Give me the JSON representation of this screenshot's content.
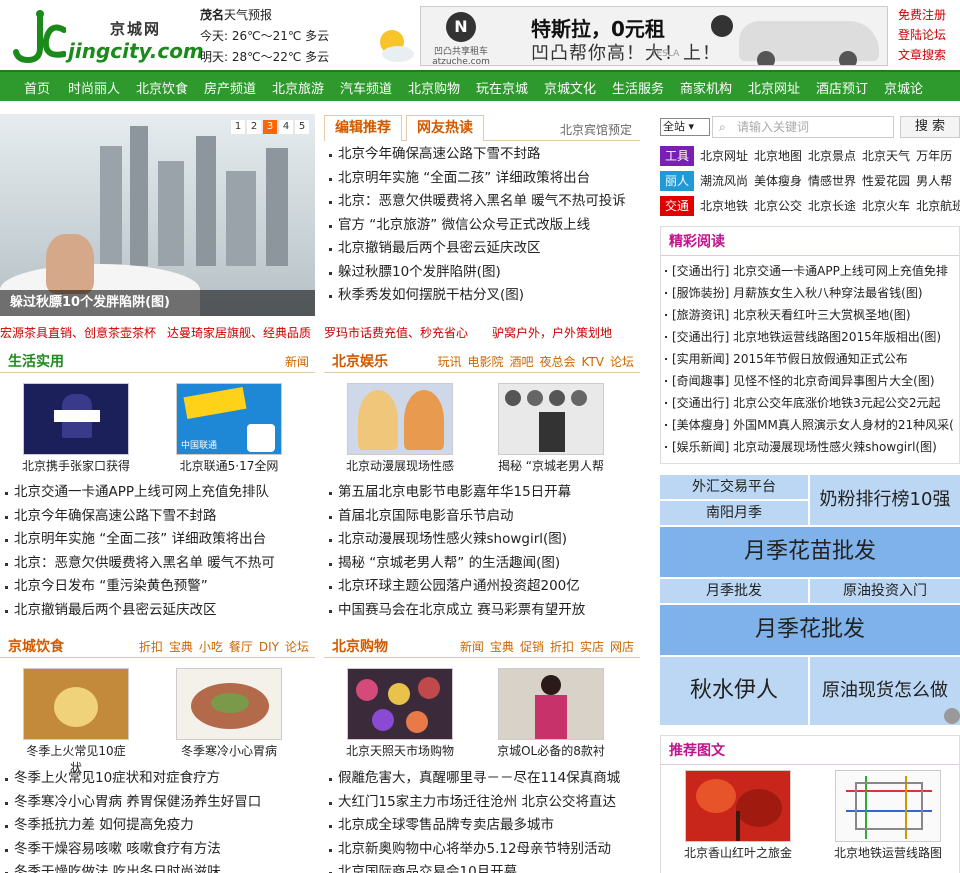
{
  "header": {
    "logo_cn": "京城网",
    "logo_en": "jingcity.com",
    "weather": {
      "location": "茂名",
      "label": "天气预报",
      "today": "今天: 26℃～21℃  多云",
      "tomorrow": "明天: 28℃～22℃  多云"
    },
    "ad": {
      "brand_name": "凹凸共享租车",
      "brand_url": "atzuche.com",
      "headline": "特斯拉，0元租",
      "subline": "凹凸帮你高！大！上！",
      "car_brand": "TESLA"
    },
    "top_links": [
      "免费注册",
      "登陆论坛",
      "文章搜索"
    ]
  },
  "nav": [
    "首页",
    "时尚丽人",
    "北京饮食",
    "房产频道",
    "北京旅游",
    "汽车频道",
    "北京购物",
    "玩在京城",
    "京城文化",
    "生活服务",
    "商家机构",
    "北京网址",
    "酒店预订",
    "京城论"
  ],
  "slideshow": {
    "caption": "躲过秋膘10个发胖陷阱(图)",
    "pages": [
      "1",
      "2",
      "3",
      "4",
      "5"
    ],
    "active_page": "3"
  },
  "promos": [
    "宏源茶具直销、创意茶壶茶杯",
    "达曼琦家居旗舰、经典品质",
    "罗玛市话费充值、秒充省心",
    "驴窝户外，户外策划地"
  ],
  "editor_tabs": {
    "tab1": "编辑推荐",
    "tab2": "网友热读",
    "right": "北京宾馆预定",
    "items": [
      "北京今年确保高速公路下雪不封路",
      "北京明年实施 “全面二孩” 详细政策将出台",
      "北京：恶意欠供暖费将入黑名单  暖气不热可投诉",
      "官方 “北京旅游” 微信公众号正式改版上线",
      "北京撤销最后两个县密云延庆改区",
      "躲过秋膘10个发胖陷阱(图)",
      "秋季秀发如何摆脱干枯分叉(图)"
    ]
  },
  "life": {
    "title": "生活实用",
    "more": [
      "新闻"
    ],
    "thumbs": [
      "北京携手张家口获得",
      "北京联通5·17全网"
    ],
    "items": [
      "北京交通一卡通APP上线可网上充值免排队",
      "北京今年确保高速公路下雪不封路",
      "北京明年实施 “全面二孩” 详细政策将出台",
      "北京：恶意欠供暖费将入黑名单  暖气不热可",
      "北京今日发布 “重污染黄色预警”",
      "北京撤销最后两个县密云延庆改区"
    ],
    "ad_label": "中国联通"
  },
  "ent": {
    "title": "北京娱乐",
    "more": [
      "玩讯",
      "电影院",
      "酒吧",
      "夜总会",
      "KTV",
      "论坛"
    ],
    "thumbs": [
      "北京动漫展现场性感",
      "揭秘 “京城老男人帮"
    ],
    "items": [
      "第五届北京电影节电影嘉年华15日开幕",
      "首届北京国际电影音乐节启动",
      "北京动漫展现场性感火辣showgirl(图)",
      "揭秘 “京城老男人帮” 的生活趣闻(图)",
      "北京环球主题公园落户通州投资超200亿",
      "中国赛马会在北京成立  赛马彩票有望开放"
    ]
  },
  "food": {
    "title": "京城饮食",
    "more": [
      "折扣",
      "宝典",
      "小吃",
      "餐厅",
      "DIY",
      "论坛"
    ],
    "thumbs": [
      "冬季上火常见10症状",
      "冬季寒冷小心胃病"
    ],
    "items": [
      "冬季上火常见10症状和对症食疗方",
      "冬季寒冷小心胃病  养胃保健汤养生好冒口",
      "冬季抵抗力差  如何提高免疫力",
      "冬季干燥容易咳嗽  咳嗽食疗有方法",
      "冬季干燥吃做法  吃出冬日时尚滋味"
    ]
  },
  "shop": {
    "title": "北京购物",
    "more": [
      "新闻",
      "宝典",
      "促销",
      "折扣",
      "实店",
      "网店"
    ],
    "thumbs": [
      "北京天照天市场购物",
      "京城OL必备的8款衬"
    ],
    "items": [
      "假離危害大，真醒哪里寻－－尽在114保真商城",
      "大红门15家主力市场迁往沧州  北京公交将直达",
      "北京成全球零售品牌专卖店最多城市",
      "北京新奥购物中心将举办5.12母亲节特别活动",
      "北京国际商品交易会10月开幕"
    ]
  },
  "search": {
    "scope": "全站",
    "placeholder": "请输入关键词",
    "button": "搜 索"
  },
  "quick": [
    {
      "tag": "工具",
      "color": "#7a1fb5",
      "links": [
        "北京网址",
        "北京地图",
        "北京景点",
        "北京天气",
        "万年历"
      ]
    },
    {
      "tag": "丽人",
      "color": "#1e9ad6",
      "links": [
        "潮流风尚",
        "美体瘦身",
        "情感世界",
        "性爱花园",
        "男人帮"
      ]
    },
    {
      "tag": "交通",
      "color": "#e00000",
      "links": [
        "北京地铁",
        "北京公交",
        "北京长途",
        "北京火车",
        "北京航班"
      ]
    }
  ],
  "reading": {
    "title": "精彩阅读",
    "items": [
      "[交通出行] 北京交通一卡通APP上线可网上充值免排",
      "[服饰装扮] 月薪族女生入秋八种穿法最省钱(图)",
      "[旅游资讯] 北京秋天看红叶三大赏枫圣地(图)",
      "[交通出行] 北京地铁运营线路图2015年版相出(图)",
      "[实用新闻] 2015年节假日放假通知正式公布",
      "[奇闻趣事] 见怪不怪的北京奇闻异事图片大全(图)",
      "[交通出行] 北京公交年底涨价地铁3元起公交2元起",
      "[美体瘦身] 外国MM真人照演示女人身材的21种风采(",
      "[娱乐新闻] 北京动漫展现场性感火辣showgirl(图)"
    ]
  },
  "ads": {
    "a1": "外汇交易平台",
    "a2": "奶粉排行榜10强",
    "a3": "南阳月季",
    "a4": "月季花苗批发",
    "a5": "月季批发",
    "a6": "原油投资入门",
    "a7": "月季花批发",
    "a8": "秋水伊人",
    "a9": "原油现货怎么做"
  },
  "pics": {
    "title": "推荐图文",
    "items": [
      "北京香山红叶之旅金",
      "北京地铁运营线路图"
    ]
  }
}
